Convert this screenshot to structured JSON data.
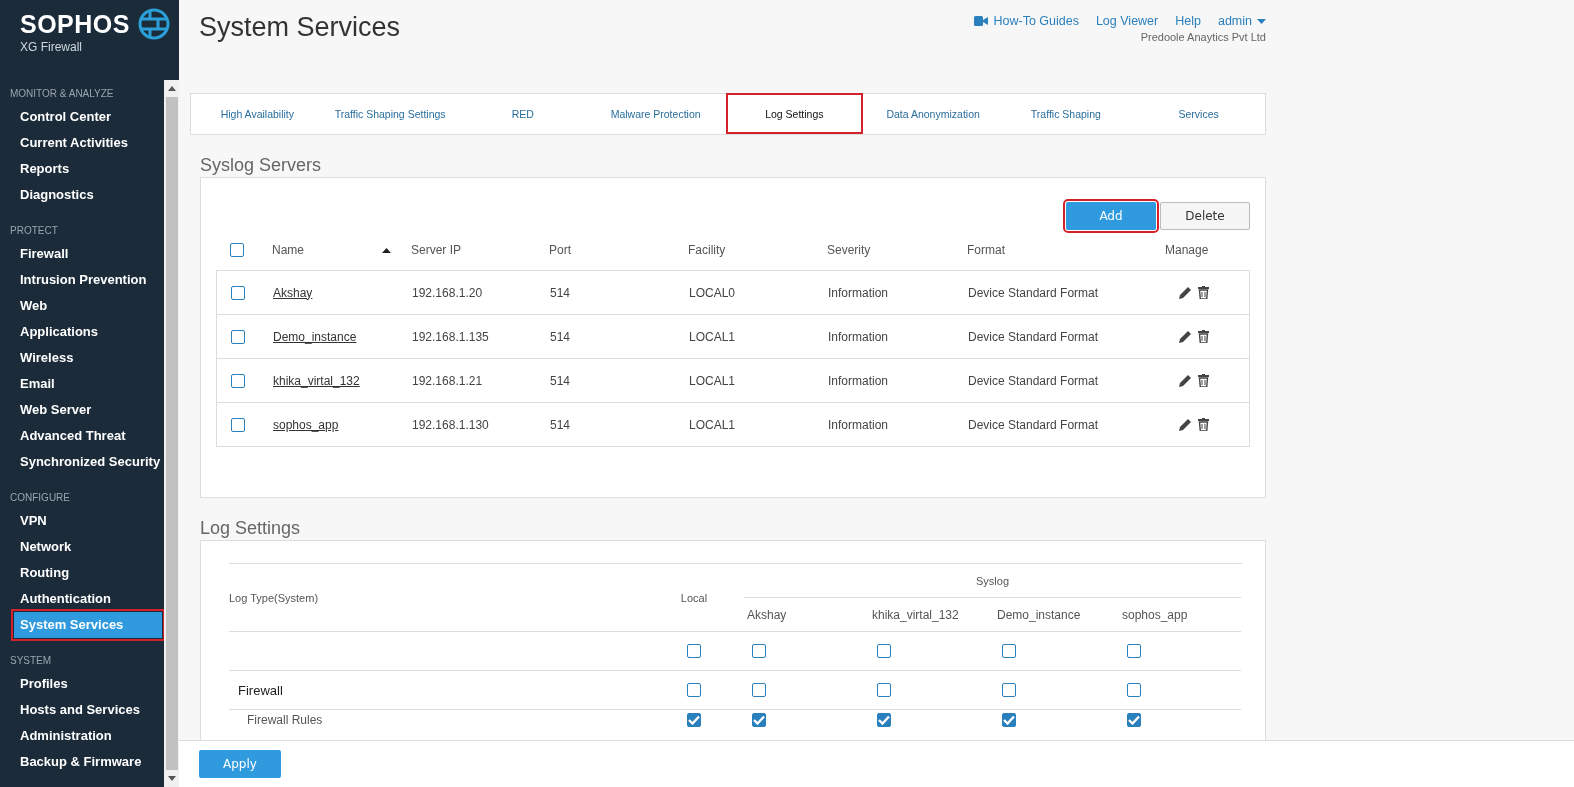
{
  "sidebar": {
    "brand": "SOPHOS",
    "product": "XG Firewall",
    "sections": [
      {
        "title": "MONITOR & ANALYZE",
        "items": [
          {
            "label": "Control Center",
            "selected": false,
            "highlighted": false
          },
          {
            "label": "Current Activities",
            "selected": false,
            "highlighted": false
          },
          {
            "label": "Reports",
            "selected": false,
            "highlighted": false
          },
          {
            "label": "Diagnostics",
            "selected": false,
            "highlighted": false
          }
        ]
      },
      {
        "title": "PROTECT",
        "items": [
          {
            "label": "Firewall",
            "selected": false,
            "highlighted": false
          },
          {
            "label": "Intrusion Prevention",
            "selected": false,
            "highlighted": false
          },
          {
            "label": "Web",
            "selected": false,
            "highlighted": false
          },
          {
            "label": "Applications",
            "selected": false,
            "highlighted": false
          },
          {
            "label": "Wireless",
            "selected": false,
            "highlighted": false
          },
          {
            "label": "Email",
            "selected": false,
            "highlighted": false
          },
          {
            "label": "Web Server",
            "selected": false,
            "highlighted": false
          },
          {
            "label": "Advanced Threat",
            "selected": false,
            "highlighted": false
          },
          {
            "label": "Synchronized Security",
            "selected": false,
            "highlighted": false
          }
        ]
      },
      {
        "title": "CONFIGURE",
        "items": [
          {
            "label": "VPN",
            "selected": false,
            "highlighted": false
          },
          {
            "label": "Network",
            "selected": false,
            "highlighted": false
          },
          {
            "label": "Routing",
            "selected": false,
            "highlighted": false
          },
          {
            "label": "Authentication",
            "selected": false,
            "highlighted": false
          },
          {
            "label": "System Services",
            "selected": true,
            "highlighted": true
          }
        ]
      },
      {
        "title": "SYSTEM",
        "items": [
          {
            "label": "Profiles",
            "selected": false,
            "highlighted": false
          },
          {
            "label": "Hosts and Services",
            "selected": false,
            "highlighted": false
          },
          {
            "label": "Administration",
            "selected": false,
            "highlighted": false
          },
          {
            "label": "Backup & Firmware",
            "selected": false,
            "highlighted": false
          }
        ]
      }
    ]
  },
  "header": {
    "title": "System Services",
    "links": [
      {
        "label": "How-To Guides",
        "kind": "video"
      },
      {
        "label": "Log Viewer",
        "kind": "plain"
      },
      {
        "label": "Help",
        "kind": "plain"
      },
      {
        "label": "admin",
        "kind": "dropdown"
      }
    ],
    "company": "Predoole Anaytics Pvt Ltd"
  },
  "tabs": [
    {
      "label": "High Availability",
      "selected": false,
      "highlighted": false
    },
    {
      "label": "Traffic Shaping Settings",
      "selected": false,
      "highlighted": false
    },
    {
      "label": "RED",
      "selected": false,
      "highlighted": false
    },
    {
      "label": "Malware Protection",
      "selected": false,
      "highlighted": false
    },
    {
      "label": "Log Settings",
      "selected": true,
      "highlighted": true
    },
    {
      "label": "Data Anonymization",
      "selected": false,
      "highlighted": false
    },
    {
      "label": "Traffic Shaping",
      "selected": false,
      "highlighted": false
    },
    {
      "label": "Services",
      "selected": false,
      "highlighted": false
    }
  ],
  "syslog_servers": {
    "title": "Syslog Servers",
    "buttons": [
      {
        "label": "Add",
        "kind": "primary",
        "highlighted": true
      },
      {
        "label": "Delete",
        "kind": "secondary",
        "highlighted": false
      }
    ],
    "select_all": {
      "checked": false
    },
    "columns": [
      {
        "label": "Name",
        "sorted": true
      },
      {
        "label": "Server IP",
        "sorted": false
      },
      {
        "label": "Port",
        "sorted": false
      },
      {
        "label": "Facility",
        "sorted": false
      },
      {
        "label": "Severity",
        "sorted": false
      },
      {
        "label": "Format",
        "sorted": false
      },
      {
        "label": "Manage",
        "sorted": false
      }
    ],
    "rows": [
      {
        "checked": false,
        "name": "Akshay",
        "server_ip": "192.168.1.20",
        "port": "514",
        "facility": "LOCAL0",
        "severity": "Information",
        "format": "Device Standard Format"
      },
      {
        "checked": false,
        "name": "Demo_instance",
        "server_ip": "192.168.1.135",
        "port": "514",
        "facility": "LOCAL1",
        "severity": "Information",
        "format": "Device Standard Format"
      },
      {
        "checked": false,
        "name": "khika_virtal_132",
        "server_ip": "192.168.1.21",
        "port": "514",
        "facility": "LOCAL1",
        "severity": "Information",
        "format": "Device Standard Format"
      },
      {
        "checked": false,
        "name": "sophos_app",
        "server_ip": "192.168.1.130",
        "port": "514",
        "facility": "LOCAL1",
        "severity": "Information",
        "format": "Device Standard Format"
      }
    ]
  },
  "log_settings": {
    "title": "Log Settings",
    "log_type_header": "Log Type(System)",
    "local_header": "Local",
    "syslog_header": "Syslog",
    "syslog_columns": [
      "Akshay",
      "khika_virtal_132",
      "Demo_instance",
      "sophos_app"
    ],
    "rows": [
      {
        "kind": "all",
        "local": false,
        "syslog": [
          false,
          false,
          false,
          false
        ]
      },
      {
        "kind": "group",
        "label": "Firewall",
        "local": false,
        "syslog": [
          false,
          false,
          false,
          false
        ]
      },
      {
        "kind": "item",
        "label": "Firewall Rules",
        "local": true,
        "syslog": [
          true,
          true,
          true,
          true
        ]
      }
    ]
  },
  "footer": {
    "apply_button": "Apply"
  }
}
